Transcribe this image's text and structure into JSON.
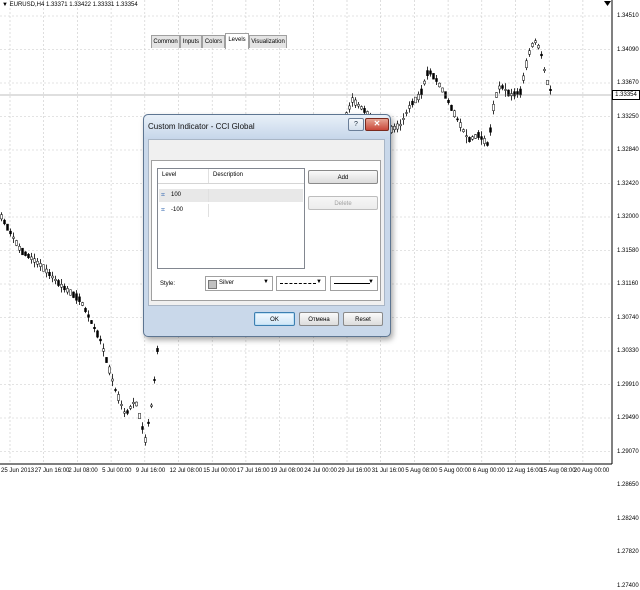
{
  "chart": {
    "symbol_label": "EURUSD,H4  1.33371 1.33422 1.33331 1.33354",
    "current_price": "1.33354",
    "price_ticks": [
      "1.34510",
      "1.34090",
      "1.33670",
      "1.33250",
      "1.32840",
      "1.32420",
      "1.32000",
      "1.31580",
      "1.31160",
      "1.30740",
      "1.30330",
      "1.29910",
      "1.29490",
      "1.29070",
      "1.28650",
      "1.28240",
      "1.27820",
      "1.27400"
    ],
    "time_ticks": [
      "25 Jun 2013",
      "27 Jun 16:00",
      "2 Jul 08:00",
      "5 Jul 00:00",
      "9 Jul 16:00",
      "12 Jul 08:00",
      "15 Jul 00:00",
      "17 Jul 16:00",
      "19 Jul 08:00",
      "24 Jul 00:00",
      "29 Jul 16:00",
      "31 Jul 16:00",
      "5 Aug 08:00",
      "5 Aug 00:00",
      "6 Aug 00:00",
      "12 Aug 16:00",
      "15 Aug 08:00",
      "20 Aug 00:00"
    ],
    "colors": {
      "candle": "#000000",
      "grid": "#c8c8c8",
      "background": "#ffffff"
    }
  },
  "dialog": {
    "title": "Custom Indicator - CCI Global",
    "help_label": "?",
    "close_label": "✕",
    "tabs": [
      "Common",
      "Inputs",
      "Colors",
      "Levels",
      "Visualization"
    ],
    "active_tab": "Levels",
    "columns": {
      "level": "Level",
      "description": "Description"
    },
    "levels": [
      {
        "icon": "level-icon",
        "value": "100",
        "description": ""
      },
      {
        "icon": "level-icon",
        "value": "-100",
        "description": ""
      }
    ],
    "add_label": "Add",
    "delete_label": "Delete",
    "style_label": "Style:",
    "color_value": "Silver",
    "color_swatch": "#c0c0c0",
    "ok_label": "OK",
    "cancel_label": "Отмена",
    "reset_label": "Reset"
  }
}
